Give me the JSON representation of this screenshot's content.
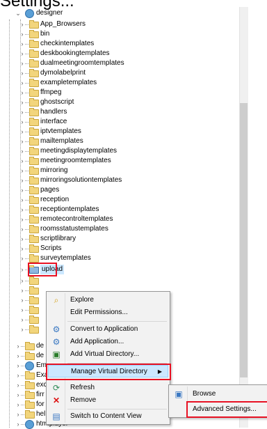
{
  "header_fragment": "Settings...",
  "tree": {
    "root": "designer",
    "items": [
      "App_Browsers",
      "bin",
      "checkintemplates",
      "deskbookingtemplates",
      "dualmeetingroomtemplates",
      "dymolabelprint",
      "exampletemplates",
      "ffmpeg",
      "ghostscript",
      "handlers",
      "interface",
      "iptvtemplates",
      "mailtemplates",
      "meetingdisplaytemplates",
      "meetingroomtemplates",
      "mirroring",
      "mirroringsolutiontemplates",
      "pages",
      "reception",
      "receptiontemplates",
      "remotecontroltemplates",
      "roomsstatustemplates",
      "scriptlibrary",
      "Scripts",
      "surveytemplates",
      "upload"
    ],
    "lower_items": [
      "de",
      "de",
      "Em",
      "Exa",
      "exc",
      "firr",
      "for",
      "hel",
      "htmlplayer"
    ]
  },
  "context_menu": {
    "items": [
      {
        "label": "Explore",
        "icon": "explore-icon"
      },
      {
        "label": "Edit Permissions...",
        "icon": ""
      },
      {
        "label": "Convert to Application",
        "icon": "convert-app-icon"
      },
      {
        "label": "Add Application...",
        "icon": "add-application-icon"
      },
      {
        "label": "Add Virtual Directory...",
        "icon": "add-virtual-directory-icon"
      },
      {
        "label": "Manage Virtual Directory",
        "icon": ""
      },
      {
        "label": "Refresh",
        "icon": "refresh-icon"
      },
      {
        "label": "Remove",
        "icon": "remove-icon"
      },
      {
        "label": "Switch to Content View",
        "icon": "content-view-icon"
      }
    ]
  },
  "submenu": {
    "items": [
      {
        "label": "Browse",
        "icon": "browse-icon"
      },
      {
        "label": "Advanced Settings...",
        "icon": ""
      }
    ]
  },
  "colors": {
    "highlight": "#e81123",
    "menu_hover": "#cce8ff"
  }
}
